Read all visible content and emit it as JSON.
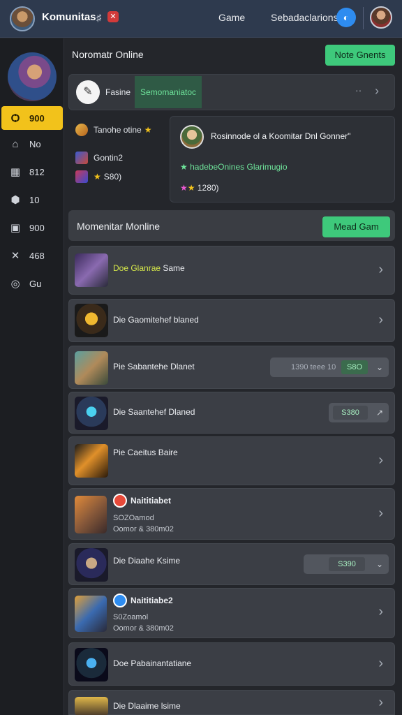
{
  "header": {
    "app_title": "Komunitas",
    "icon_mark": "♯",
    "badge": "✕",
    "nav_game": "Game",
    "nav_sub": "Sebadaclarions",
    "circle_icon": "◐"
  },
  "sidebar": {
    "items": [
      {
        "icon": "Ѻ",
        "label": "900",
        "active": true
      },
      {
        "icon": "⌂",
        "label": "No"
      },
      {
        "icon": "▦",
        "label": "812"
      },
      {
        "icon": "⬢",
        "label": "10"
      },
      {
        "icon": "▣",
        "label": "900"
      },
      {
        "icon": "✕",
        "label": "468"
      },
      {
        "icon": "◎",
        "label": "Gu"
      }
    ]
  },
  "main": {
    "title": "Noromatr Online",
    "top_button": "Note Gnents",
    "search": {
      "label": "Fasine",
      "value": "Semomaniatoc",
      "dash": "··"
    },
    "left_card": {
      "title": "Tanohe otine",
      "row1": "Gontin2",
      "row2": "S80)"
    },
    "feature": {
      "title": "Rosinnode ol a Koomitar Dnl Gonner\"",
      "sub": "hadebeOnines Glarimugio",
      "stars": "1280)"
    },
    "section": {
      "title": "Momenitar Monline",
      "button": "Mead Gam"
    },
    "list": [
      {
        "title_hl": "Doe Glanrae",
        "title": " Same"
      },
      {
        "title": "Die Gaomitehef blaned"
      },
      {
        "title": "Pie Sabantehe Dlanet",
        "pill_text": "1390 teee 10",
        "pill_val": "S8O"
      },
      {
        "title": "Die Saantehef Dlaned",
        "pill_val": "S380"
      },
      {
        "title": "Pie Caeitus Baire"
      },
      {
        "title": "Naititiabet",
        "sub1": "SOZOamod",
        "sub2": "Oomor & 380m02"
      },
      {
        "title": "Die Diaahe Ksime",
        "pill_val": "S390"
      },
      {
        "title": "Naititiabe2",
        "sub1": "S0Zoamol",
        "sub2": "Oomor & 380m02"
      },
      {
        "title": "Doe Pabainantatiane"
      },
      {
        "title": "Die Dlaaime lsime"
      }
    ]
  }
}
